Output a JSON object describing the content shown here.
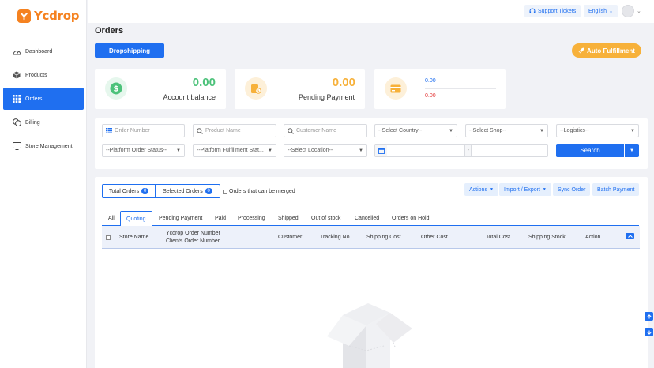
{
  "brand": {
    "name": "Ycdrop",
    "color": "#f58220"
  },
  "sidebar": {
    "items": [
      {
        "label": "Dashboard",
        "icon": "gauge-icon",
        "active": false
      },
      {
        "label": "Products",
        "icon": "box-icon",
        "active": false
      },
      {
        "label": "Orders",
        "icon": "grid-icon",
        "active": true
      },
      {
        "label": "Billing",
        "icon": "coins-icon",
        "active": false
      },
      {
        "label": "Store Management",
        "icon": "store-icon",
        "active": false
      }
    ]
  },
  "topbar": {
    "support_label": "Support Tickets",
    "language": "English"
  },
  "page": {
    "title": "Orders",
    "dropshipping_label": "Dropshipping",
    "auto_fulfillment_label": "Auto Fulfillment"
  },
  "cards": {
    "account_balance": {
      "value": "0.00",
      "label": "Account balance"
    },
    "pending_payment": {
      "value": "0.00",
      "label": "Pending Payment"
    },
    "card3": {
      "value_top": "0.00",
      "value_bottom": "0.00"
    }
  },
  "filters": {
    "order_number_placeholder": "Order Number",
    "product_name_placeholder": "Product Name",
    "customer_name_placeholder": "Customer Name",
    "country": "--Select Country--",
    "shop": "--Select Shop--",
    "logistics": "--Logistics--",
    "platform_order_status": "--Platform Order Status--",
    "platform_fulfillment_status": "--Platform Fulfillment Stat...",
    "location": "--Select Location--",
    "date_separator": "-",
    "search_label": "Search"
  },
  "orders": {
    "total_orders_label": "Total Orders",
    "total_orders_count": "0",
    "selected_orders_label": "Selected Orders",
    "selected_orders_count": "0",
    "merge_label": "Orders that can be merged",
    "actions_label": "Actions",
    "import_export_label": "Import / Export",
    "sync_order_label": "Sync Order",
    "batch_payment_label": "Batch Payment",
    "tabs": [
      "All",
      "Quoting",
      "Pending Payment",
      "Paid",
      "Processing",
      "Shipped",
      "Out of stock",
      "Cancelled",
      "Orders on Hold"
    ],
    "active_tab": "Quoting",
    "columns": {
      "store_name": "Store Name",
      "order_number_line1": "Ycdrop Order Number",
      "order_number_line2": "Clients Order Number",
      "customer": "Customer",
      "tracking_no": "Tracking No",
      "shipping_cost": "Shipping Cost",
      "other_cost": "Other Cost",
      "total_cost": "Total Cost",
      "shipping_stock": "Shipping Stock",
      "action": "Action"
    }
  },
  "colors": {
    "primary": "#1f6ff0",
    "accent": "#f7b13a",
    "success": "#4cc27a",
    "danger": "#e43b3b"
  }
}
